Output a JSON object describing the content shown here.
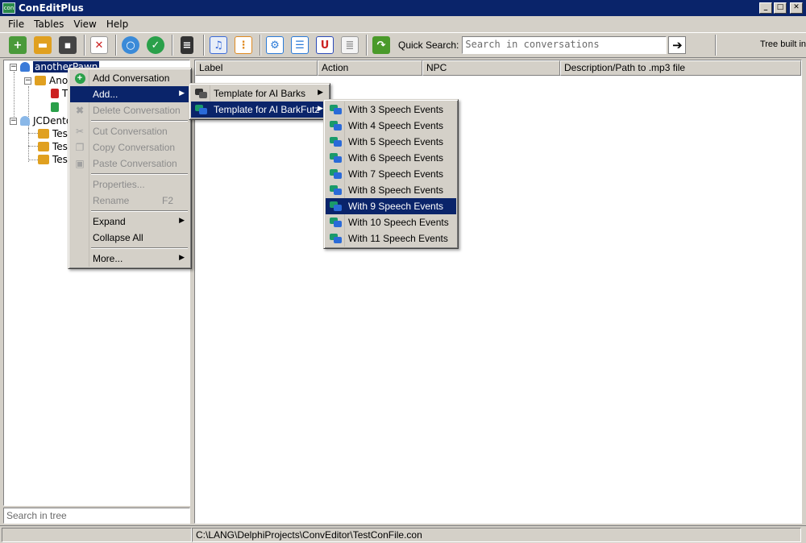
{
  "window": {
    "title": "ConEditPlus",
    "icon_label": "con",
    "controls": [
      "_",
      "□",
      "✕"
    ]
  },
  "menubar": [
    {
      "label": "File"
    },
    {
      "label": "Tables"
    },
    {
      "label": "View"
    },
    {
      "label": "Help"
    }
  ],
  "toolbar": {
    "buttons": [
      {
        "name": "new-file-icon",
        "color": "#4a9a3a"
      },
      {
        "name": "open-folder-icon",
        "color": "#e0a020"
      },
      {
        "name": "save-disk-icon",
        "color": "#444444"
      },
      {
        "name": "delete-file-icon",
        "color": "#cc2222"
      },
      {
        "name": "search-icon",
        "color": "#3a8ad8"
      },
      {
        "name": "check-icon",
        "color": "#2aa04a"
      },
      {
        "name": "sd-card-icon",
        "color": "#333333"
      },
      {
        "name": "music-note-icon",
        "color": "#3a6ad8"
      },
      {
        "name": "flowchart-icon",
        "color": "#e08a20"
      },
      {
        "name": "gear-icon",
        "color": "#2a7ad8"
      },
      {
        "name": "list-icon",
        "color": "#2a7ad8"
      },
      {
        "name": "magnet-icon",
        "color": "#2a4ab8"
      },
      {
        "name": "document-icon",
        "color": "#9a9a9a"
      },
      {
        "name": "refresh-arrow-icon",
        "color": "#4a9a2a"
      }
    ],
    "quick_search_label": "Quick Search:",
    "quick_search_placeholder": "Search in conversations",
    "quick_search_go": "➔",
    "tree_built_text": "Tree built in"
  },
  "tree": {
    "nodes": [
      {
        "label": "anotherPawn",
        "selected": true
      },
      {
        "label": "Ano"
      },
      {
        "label": "T"
      },
      {
        "label": ""
      },
      {
        "label": "JCDento"
      },
      {
        "label": "Test"
      },
      {
        "label": "Test"
      },
      {
        "label": "Test"
      }
    ],
    "search_placeholder": "Search in tree"
  },
  "grid": {
    "columns": [
      "Label",
      "Action",
      "NPC",
      "Description/Path to .mp3 file"
    ]
  },
  "statusbar": {
    "path": "C:\\LANG\\DelphiProjects\\ConvEditor\\TestConFile.con"
  },
  "context_menu": {
    "items": [
      {
        "label": "Add Conversation",
        "icon": "plus-circle-icon"
      },
      {
        "label": "Add...",
        "highlighted": true,
        "submenu": true
      },
      {
        "label": "Delete Conversation",
        "disabled": true,
        "icon": "x-icon"
      },
      {
        "sep": true
      },
      {
        "label": "Cut Conversation",
        "disabled": true,
        "icon": "scissors-icon"
      },
      {
        "label": "Copy Conversation",
        "disabled": true,
        "icon": "copy-icon"
      },
      {
        "label": "Paste Conversation",
        "disabled": true,
        "icon": "clipboard-icon"
      },
      {
        "sep": true
      },
      {
        "label": "Properties...",
        "disabled": true
      },
      {
        "label": "Rename",
        "disabled": true,
        "shortcut": "F2"
      },
      {
        "sep": true
      },
      {
        "label": "Expand",
        "submenu": true
      },
      {
        "label": "Collapse All"
      },
      {
        "sep": true
      },
      {
        "label": "More...",
        "submenu": true
      }
    ]
  },
  "add_submenu": {
    "items": [
      {
        "label": "Template for AI Barks"
      },
      {
        "label": "Template for AI BarkFutz",
        "highlighted": true
      }
    ]
  },
  "template_submenu": {
    "items": [
      {
        "label": "With 3 Speech Events"
      },
      {
        "label": "With 4 Speech Events"
      },
      {
        "label": "With 5 Speech Events"
      },
      {
        "label": "With 6 Speech Events"
      },
      {
        "label": "With 7 Speech Events"
      },
      {
        "label": "With 8 Speech Events"
      },
      {
        "label": "With 9 Speech Events",
        "highlighted": true
      },
      {
        "label": "With 10 Speech Events"
      },
      {
        "label": "With 11 Speech Events"
      }
    ]
  },
  "colors": {
    "selection": "#0a246a",
    "face": "#d4d0c8"
  }
}
